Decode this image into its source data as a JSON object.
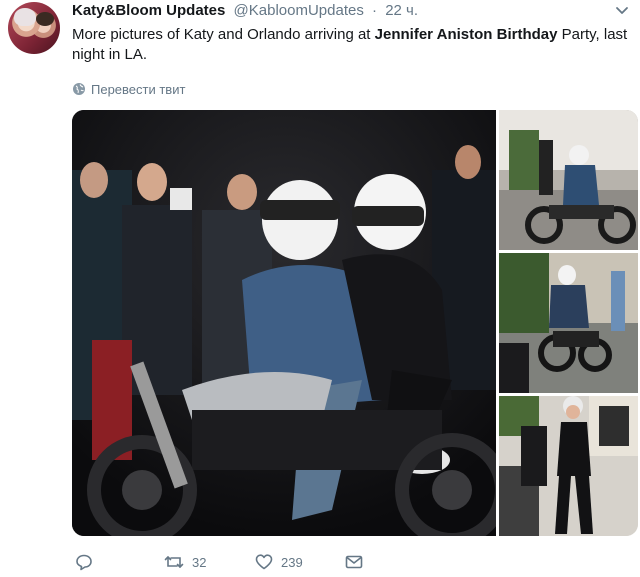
{
  "tweet": {
    "display_name": "Katy&Bloom Updates",
    "handle": "@KabloomUpdates",
    "separator": "·",
    "time": "22 ч.",
    "text_1": "More pictures of Katy and Orlando arriving at ",
    "text_bold": "Jennifer Aniston Birthday",
    "text_2": " Party, last night in LA.",
    "translate_label": "Перевести твит"
  },
  "actions": {
    "retweets": "32",
    "likes": "239"
  },
  "icons": {
    "reply": "reply-icon",
    "retweet": "retweet-icon",
    "like": "heart-icon",
    "dm": "envelope-icon",
    "translate": "globe-icon",
    "menu": "chevron-down-icon"
  },
  "colors": {
    "text": "#14171a",
    "muted": "#657786"
  }
}
